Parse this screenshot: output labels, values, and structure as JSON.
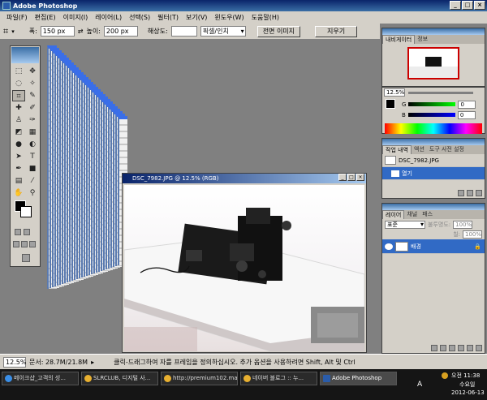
{
  "app": {
    "title": "Adobe Photoshop"
  },
  "menu": [
    "파일(F)",
    "편집(E)",
    "이미지(I)",
    "레이어(L)",
    "선택(S)",
    "필터(T)",
    "보기(V)",
    "윈도우(W)",
    "도움말(H)"
  ],
  "options": {
    "width_label": "폭:",
    "width_value": "150 px",
    "height_label": "높이:",
    "height_value": "200 px",
    "resolution_label": "해상도:",
    "resolution_value": "",
    "unit_value": "픽셀/인치",
    "front_image_button": "전면 이미지",
    "clear_button": "지우기"
  },
  "document": {
    "title": "DSC_7982.JPG @ 12.5% (RGB)"
  },
  "navigator": {
    "tabs": [
      "내비게이터",
      "정보"
    ],
    "zoom": "12.5%"
  },
  "color": {
    "g_label": "G",
    "g_value": "0",
    "b_label": "B",
    "b_value": "0"
  },
  "history": {
    "tabs": [
      "작업 내역",
      "액션",
      "도구 사전 설정"
    ],
    "snapshot": "DSC_7982.JPG",
    "items": [
      "열기"
    ]
  },
  "layers": {
    "tabs": [
      "레이어",
      "채널",
      "패스"
    ],
    "mode": "표준",
    "opacity_label": "불투명도:",
    "opacity_value": "100%",
    "fill_label": "칠:",
    "fill_value": "100%",
    "layer_name": "배경"
  },
  "status": {
    "zoom": "12.5%",
    "doc_label": "문서: 28.7M/21.8M",
    "hint": "클릭-드래그하여 자를 프레임을 정의하십시오.  추가 옵션을 사용하려면 Shift, Alt 및 Ctrl"
  },
  "taskbar": {
    "items": [
      "메이크샵_고객의 성...",
      "SLRCLUB, 디지털 사...",
      "http://premium102.ma...",
      "네이버 블로그 :: 누...",
      "Adobe Photoshop"
    ],
    "time": "오전 11:38",
    "day": "수요일",
    "date": "2012-06-13",
    "lang": "A"
  }
}
